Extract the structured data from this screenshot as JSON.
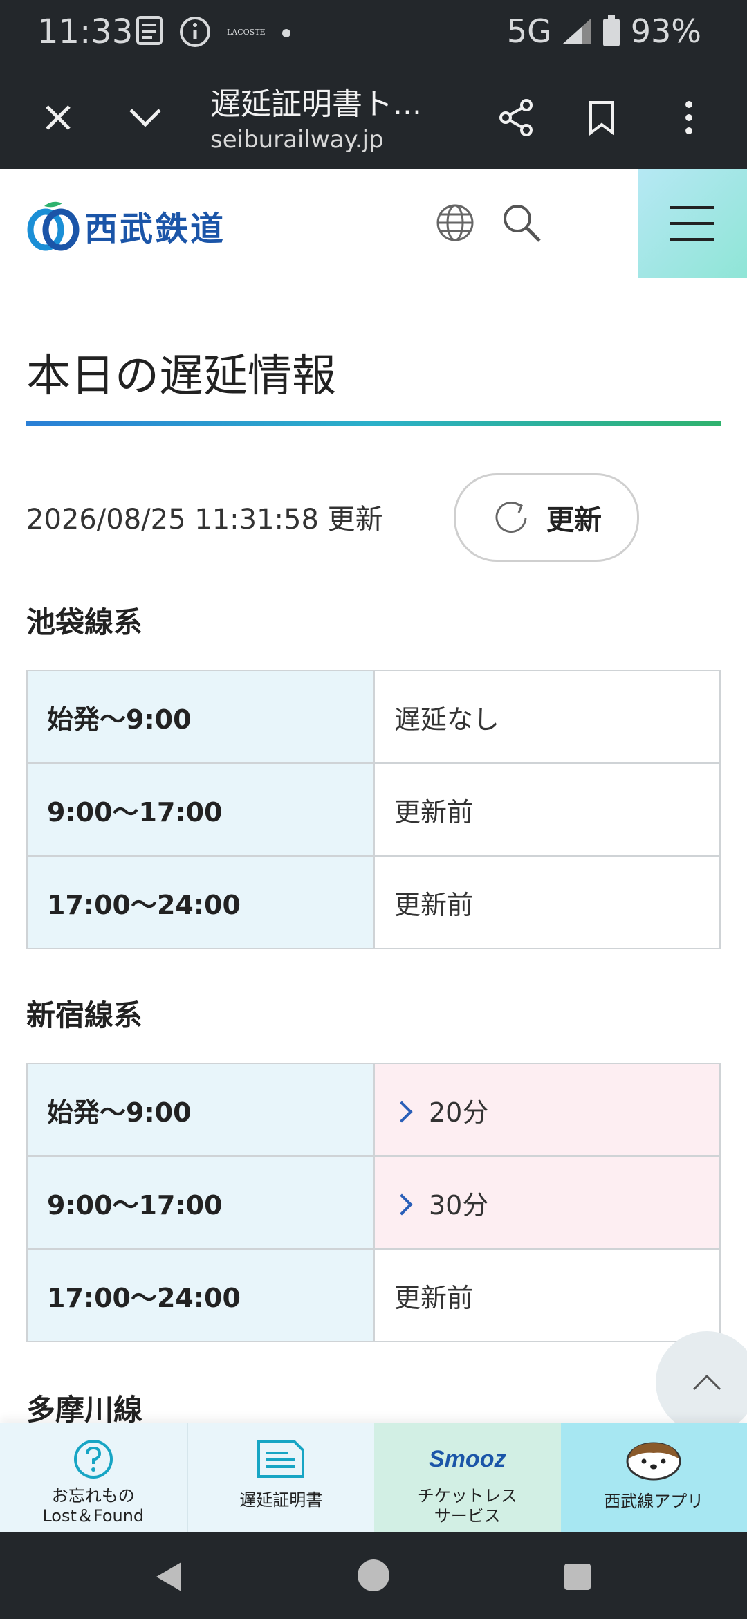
{
  "status_bar": {
    "time": "11:33",
    "lacoste": "LACOSTE",
    "network": "5G",
    "battery": "93%"
  },
  "browser": {
    "title": "遅延証明書ト...",
    "url": "seiburailway.jp"
  },
  "site": {
    "logo_text": "西武鉄道"
  },
  "page": {
    "title": "本日の遅延情報",
    "updated": "2026/08/25 11:31:58 更新",
    "refresh_label": "更新"
  },
  "sections": [
    {
      "title": "池袋線系",
      "rows": [
        {
          "time": "始発～9:00",
          "status": "遅延なし"
        },
        {
          "time": "9:00～17:00",
          "status": "更新前"
        },
        {
          "time": "17:00～24:00",
          "status": "更新前"
        }
      ]
    },
    {
      "title": "新宿線系",
      "rows": [
        {
          "time": "始発～9:00",
          "status": "20分"
        },
        {
          "time": "9:00～17:00",
          "status": "30分"
        },
        {
          "time": "17:00～24:00",
          "status": "更新前"
        }
      ]
    },
    {
      "title": "多摩川線"
    }
  ],
  "bottom_nav": [
    {
      "line1": "お忘れもの",
      "line2": "Lost＆Found"
    },
    {
      "line1": "遅延証明書"
    },
    {
      "logo": "Smooz",
      "line1": "チケットレス",
      "line2": "サービス"
    },
    {
      "line1": "西武線アプリ"
    }
  ],
  "colors": {
    "brand_blue": "#1b55a8",
    "delayed_bg": "#fdeef2",
    "time_bg": "#e8f5fa"
  }
}
